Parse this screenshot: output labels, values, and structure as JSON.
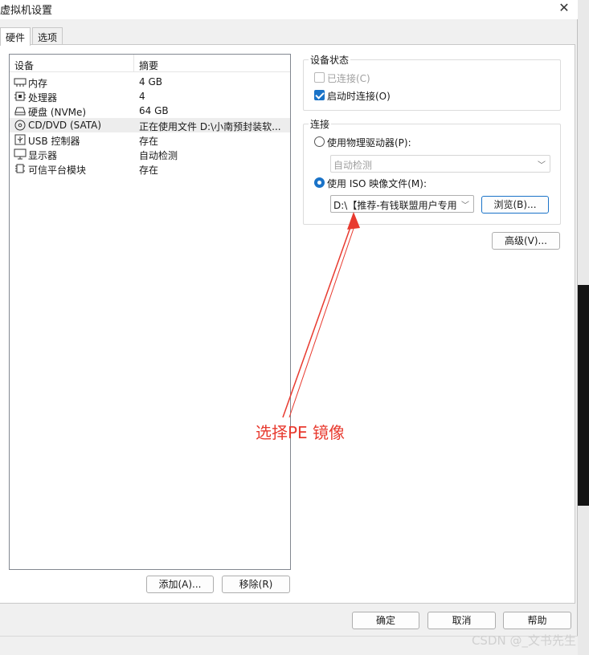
{
  "window": {
    "title": "虚拟机设置"
  },
  "tabs": [
    {
      "label": "硬件"
    },
    {
      "label": "选项"
    }
  ],
  "device_list": {
    "headers": {
      "device": "设备",
      "summary": "摘要"
    },
    "rows": [
      {
        "icon": "memory-icon",
        "name": "内存",
        "summary": "4 GB"
      },
      {
        "icon": "processor-icon",
        "name": "处理器",
        "summary": "4"
      },
      {
        "icon": "hard-disk-icon",
        "name": "硬盘 (NVMe)",
        "summary": "64 GB"
      },
      {
        "icon": "cd-dvd-icon",
        "name": "CD/DVD (SATA)",
        "summary": "正在使用文件 D:\\小南预封装软..."
      },
      {
        "icon": "usb-icon",
        "name": "USB 控制器",
        "summary": "存在"
      },
      {
        "icon": "display-icon",
        "name": "显示器",
        "summary": "自动检测"
      },
      {
        "icon": "tpm-icon",
        "name": "可信平台模块",
        "summary": "存在"
      }
    ]
  },
  "list_buttons": {
    "add": "添加(A)...",
    "remove": "移除(R)"
  },
  "device_status": {
    "title": "设备状态",
    "connected": "已连接(C)",
    "connect_at_power_on": "启动时连接(O)"
  },
  "connection": {
    "title": "连接",
    "physical_drive": "使用物理驱动器(P):",
    "physical_drive_value": "自动检测",
    "iso_image": "使用 ISO 映像文件(M):",
    "iso_path": "D:\\【推荐-有钱联盟用户专用",
    "browse": "浏览(B)..."
  },
  "advanced_button": "高级(V)...",
  "dialog_buttons": {
    "ok": "确定",
    "cancel": "取消",
    "help": "帮助"
  },
  "annotation": "选择PE 镜像",
  "watermark": "CSDN @_文书先生",
  "colors": {
    "accent": "#1a73c8",
    "annotation": "#e83a2f"
  }
}
